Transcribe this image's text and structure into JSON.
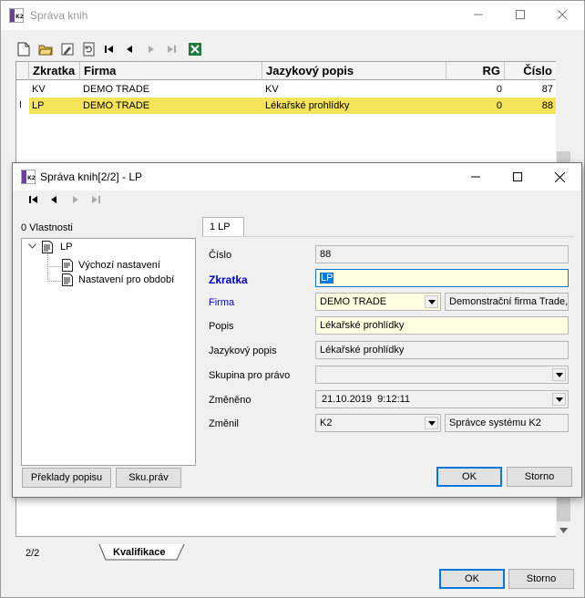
{
  "main_window": {
    "title": "Správa knih",
    "grid": {
      "columns": [
        "Zkratka",
        "Firma",
        "Jazykový popis",
        "RG",
        "Číslo"
      ],
      "rows": [
        {
          "zkratka": "KV",
          "firma": "DEMO TRADE",
          "popis": "KV",
          "rg": "0",
          "cislo": "87"
        },
        {
          "zkratka": "LP",
          "firma": "DEMO TRADE",
          "popis": "Lékařské prohlídky",
          "rg": "0",
          "cislo": "88"
        }
      ],
      "row_marker": "I"
    },
    "status": {
      "record_position": "2/2",
      "tab_label": "Kvalifikace"
    },
    "buttons": {
      "ok": "OK",
      "cancel": "Storno"
    }
  },
  "dialog": {
    "title": "Správa knih[2/2] - LP",
    "properties_label": "0 Vlastnosti",
    "tree": {
      "root": "LP",
      "children": [
        "Výchozí nastavení",
        "Nastavení pro období"
      ]
    },
    "tab_label": "1 LP",
    "fields": {
      "cislo": {
        "label": "Číslo",
        "value": "88"
      },
      "zkratka": {
        "label": "Zkratka",
        "value": "LP"
      },
      "firma": {
        "label": "Firma",
        "value": "DEMO TRADE",
        "description": "Demonstrační firma Trade,"
      },
      "popis": {
        "label": "Popis",
        "value": "Lékařské prohlídky"
      },
      "jazykovy_popis": {
        "label": "Jazykový popis",
        "value": "Lékařské prohlídky"
      },
      "skupina": {
        "label": "Skupina pro právo",
        "value": ""
      },
      "zmeneno": {
        "label": "Změněno",
        "value": "21.10.2019  9:12:11"
      },
      "zmenil": {
        "label": "Změnil",
        "value": "K2",
        "description": "Správce systému K2"
      }
    },
    "buttons": {
      "translations": "Překlady popisu",
      "sku_prav": "Sku.práv",
      "ok": "OK",
      "cancel": "Storno"
    }
  },
  "colors": {
    "selection_yellow": "#f5e35a",
    "required_field_yellow": "#ffffe1",
    "readonly_field": "#f0f0f0",
    "link_blue": "#0000c8",
    "focus_blue": "#0078d7"
  }
}
